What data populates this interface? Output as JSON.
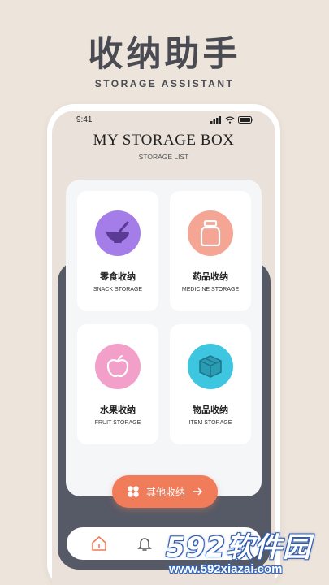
{
  "promo": {
    "title": "收纳助手",
    "subtitle": "STORAGE ASSISTANT"
  },
  "status_bar": {
    "time": "9:41"
  },
  "app": {
    "title": "MY STORAGE BOX",
    "subtitle": "STORAGE LIST"
  },
  "cards": [
    {
      "label": "零食收纳",
      "sub": "SNACK STORAGE",
      "icon": "bowl-icon",
      "color": "#a57de8"
    },
    {
      "label": "药品收纳",
      "sub": "MEDICINE STORAGE",
      "icon": "medicine-jar-icon",
      "color": "#f4a594"
    },
    {
      "label": "水果收纳",
      "sub": "FRUIT STORAGE",
      "icon": "apple-icon",
      "color": "#f29fc9"
    },
    {
      "label": "物品收纳",
      "sub": "ITEM STORAGE",
      "icon": "box-icon",
      "color": "#3ec6e0"
    }
  ],
  "other_button": {
    "label": "其他收纳",
    "color": "#f07c5a"
  },
  "tab_bar": {
    "tabs": [
      "home-icon",
      "bell-icon"
    ],
    "active_color": "#f07c5a"
  },
  "watermark": {
    "logo": "592软件园",
    "url": "www.592xiazai.com"
  },
  "colors": {
    "background": "#ede4dc",
    "dark_panel": "#565a66",
    "title_text": "#4a4b52"
  }
}
